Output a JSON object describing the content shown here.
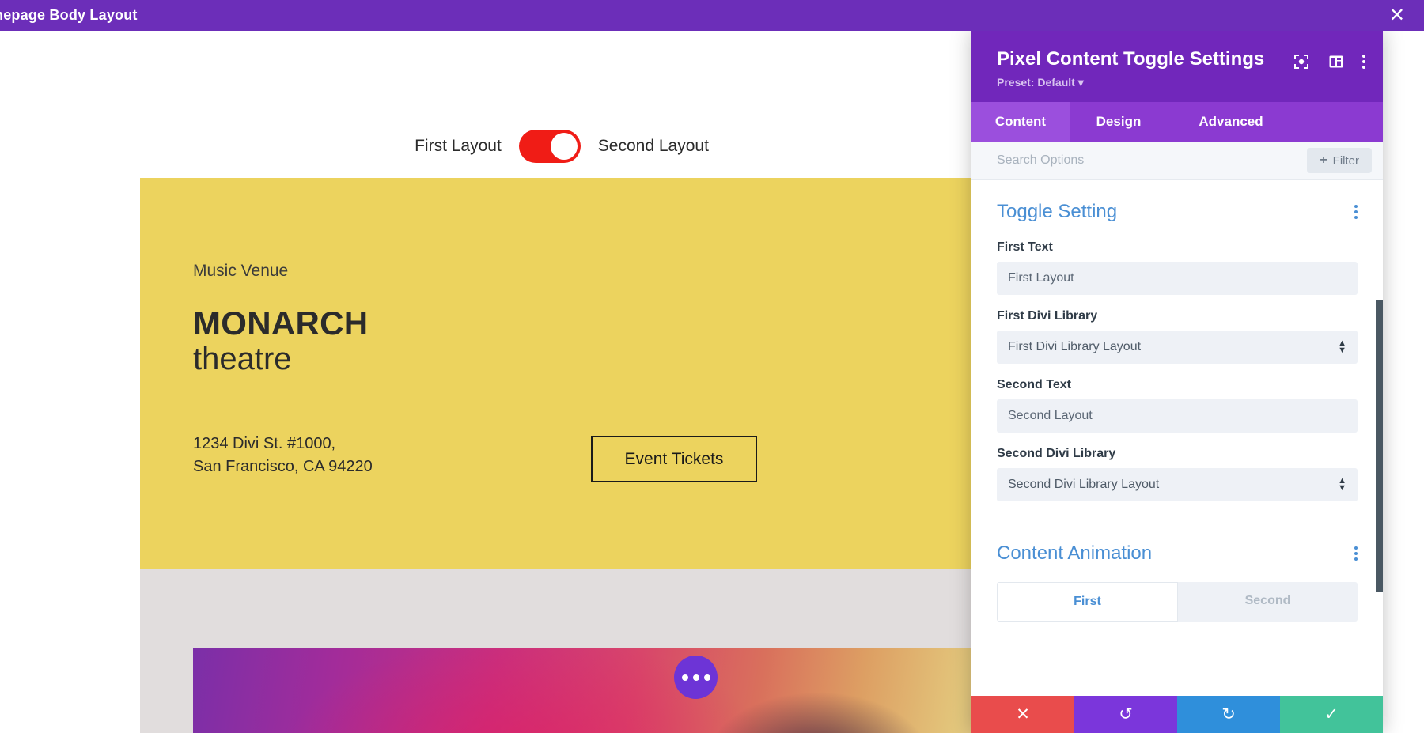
{
  "top_bar": {
    "title": "mepage Body Layout",
    "close_icon": "close-icon"
  },
  "canvas": {
    "toggle": {
      "first_label": "First Layout",
      "second_label": "Second Layout",
      "state": "second",
      "track_color": "#f01c16",
      "knob_color": "#ffffff"
    },
    "hero": {
      "background_color": "#ecd35e",
      "eyebrow": "Music Venue",
      "title_strong": "MONARCH",
      "title_light": "theatre",
      "address": "1234 Divi St. #1000,\nSan Francisco, CA 94220",
      "button_label": "Event Tickets"
    },
    "gray_band_color": "#e1dddd",
    "photo": {
      "overlay_button_icon": "ellipsis-icon",
      "overlay_button_color": "#6d34d6"
    }
  },
  "panel": {
    "title": "Pixel Content Toggle Settings",
    "preset": "Preset: Default",
    "preset_caret": "▾",
    "header_color": "#7127bb",
    "header_icons": [
      {
        "name": "focus-target-icon"
      },
      {
        "name": "split-layout-icon"
      },
      {
        "name": "more-vertical-icon"
      }
    ],
    "tabs": [
      {
        "label": "Content",
        "active": true
      },
      {
        "label": "Design",
        "active": false
      },
      {
        "label": "Advanced",
        "active": false
      }
    ],
    "search": {
      "placeholder": "Search Options",
      "value": "",
      "filter_label": "Filter",
      "filter_plus": "+"
    },
    "sections": [
      {
        "title": "Toggle Setting",
        "menu_icon": "more-vertical-icon",
        "fields": [
          {
            "label": "First Text",
            "type": "text",
            "value": "First Layout"
          },
          {
            "label": "First Divi Library",
            "type": "select",
            "value": "First Divi Library Layout"
          },
          {
            "label": "Second Text",
            "type": "text",
            "value": "Second Layout"
          },
          {
            "label": "Second Divi Library",
            "type": "select",
            "value": "Second Divi Library Layout"
          }
        ]
      },
      {
        "title": "Content Animation",
        "menu_icon": "more-vertical-icon",
        "segmented": {
          "options": [
            "First",
            "Second"
          ],
          "selected": "First"
        }
      }
    ],
    "scrollbar": {
      "color": "#4a5863"
    },
    "footer": [
      {
        "name": "cancel-button",
        "icon": "✕",
        "color": "#e94c4c"
      },
      {
        "name": "undo-button",
        "icon": "↺",
        "color": "#7b36db"
      },
      {
        "name": "redo-button",
        "icon": "↻",
        "color": "#2f8fdb"
      },
      {
        "name": "save-button",
        "icon": "✓",
        "color": "#42c39a"
      }
    ]
  }
}
